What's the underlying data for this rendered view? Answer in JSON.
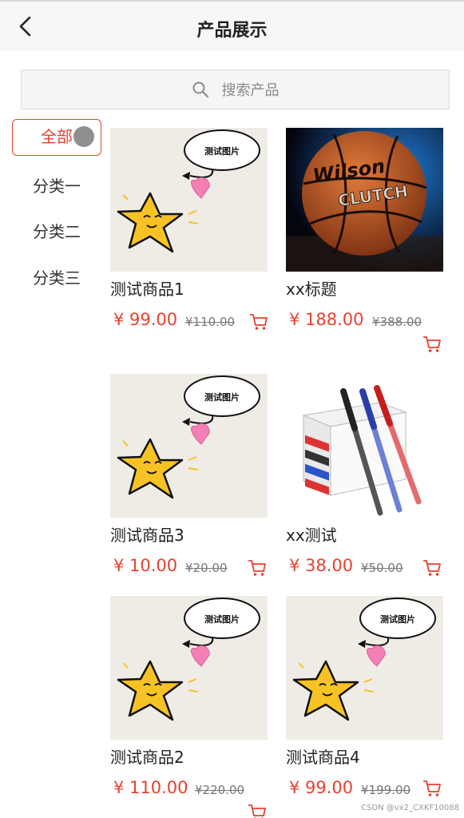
{
  "header": {
    "title": "产品展示",
    "back_icon": "chevron-left-icon"
  },
  "search": {
    "placeholder": "搜索产品",
    "icon": "search-icon"
  },
  "categories": [
    {
      "label": "全部",
      "active": true
    },
    {
      "label": "分类一",
      "active": false
    },
    {
      "label": "分类二",
      "active": false
    },
    {
      "label": "分类三",
      "active": false
    }
  ],
  "products": [
    {
      "name": "测试商品1",
      "price": "¥ 99.00",
      "original_price": "¥110.00",
      "image": "star-placeholder",
      "image_caption": "测试图片"
    },
    {
      "name": "xx标题",
      "price": "¥ 188.00",
      "original_price": "¥388.00",
      "image": "basketball",
      "image_text": [
        "Wilson",
        "CLUTCH"
      ]
    },
    {
      "name": "测试商品3",
      "price": "¥ 10.00",
      "original_price": "¥20.00",
      "image": "star-placeholder",
      "image_caption": "测试图片"
    },
    {
      "name": "xx测试",
      "price": "¥ 38.00",
      "original_price": "¥50.00",
      "image": "gel-pens"
    },
    {
      "name": "测试商品2",
      "price": "¥ 110.00",
      "original_price": "¥220.00",
      "image": "star-placeholder",
      "image_caption": "测试图片"
    },
    {
      "name": "测试商品4",
      "price": "¥ 99.00",
      "original_price": "¥199.00",
      "image": "star-placeholder",
      "image_caption": "测试图片"
    }
  ],
  "cart_icon": "cart-icon",
  "watermark": "CSDN @vx2_CXKF10088",
  "colors": {
    "accent": "#e8412f",
    "star": "#f7c324",
    "heart": "#f47fb4",
    "search_bg": "#f5f5f5"
  }
}
